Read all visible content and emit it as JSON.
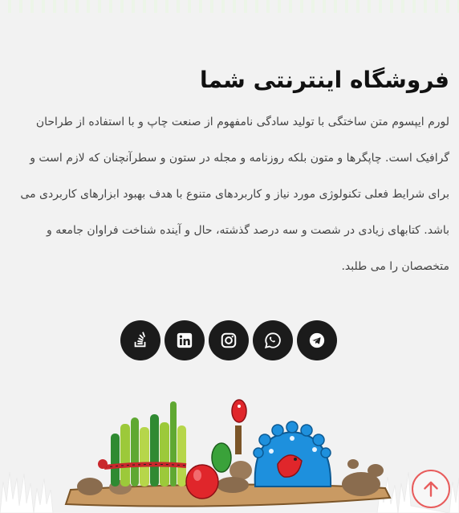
{
  "store": {
    "title": "فروشگاه اینترنتی شما",
    "description": "لورم ایپسوم متن ساختگی با تولید سادگی نامفهوم از صنعت چاپ و با استفاده از طراحان گرافیک است. چاپگرها و متون بلکه روزنامه و مجله در ستون و سطرآنچنان که لازم است و برای شرایط فعلی تکنولوژی مورد نیاز و کاربردهای متنوع با هدف بهبود ابزارهای کاربردی می باشد. کتابهای زیادی در شصت و سه درصد گذشته، حال و آینده شناخت فراوان جامعه و متخصصان را می طلبد."
  },
  "social": [
    {
      "name": "stackoverflow-icon",
      "color": "#ffffff"
    },
    {
      "name": "linkedin-icon",
      "color": "#ffffff"
    },
    {
      "name": "instagram-icon",
      "color": "#ffffff"
    },
    {
      "name": "whatsapp-icon",
      "color": "#ffffff"
    },
    {
      "name": "telegram-icon",
      "color": "#ffffff"
    }
  ],
  "colors": {
    "background": "#f2f2f2",
    "social_bg": "#1b1b1b",
    "scroll_top_accent": "#e85c5c"
  },
  "icons": {
    "scroll_top": "arrow-up-icon",
    "decoration": "haft-sin-illustration"
  }
}
